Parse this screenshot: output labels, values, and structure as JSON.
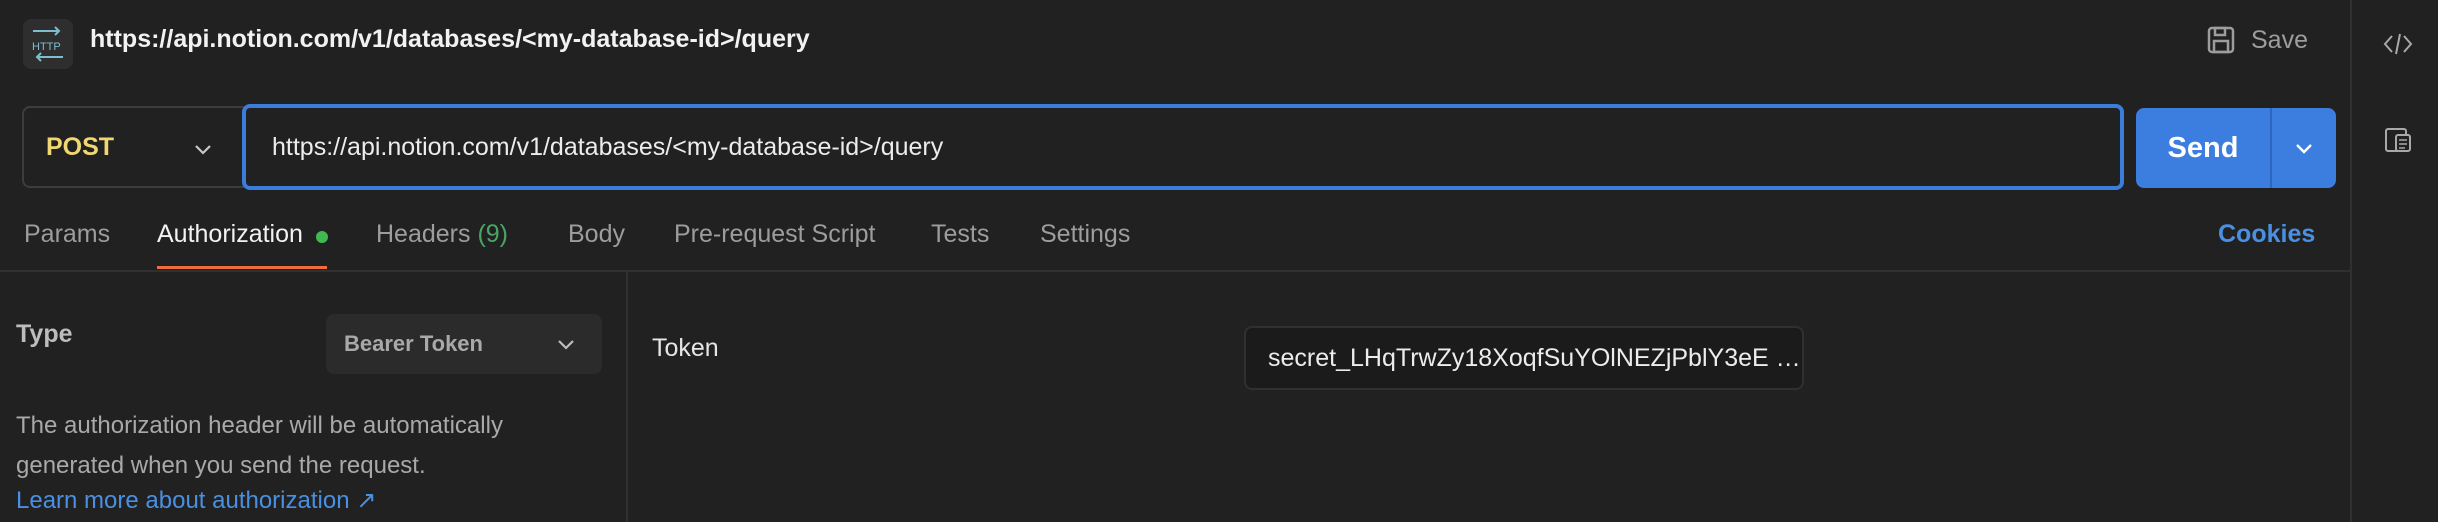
{
  "header": {
    "title": "https://api.notion.com/v1/databases/<my-database-id>/query",
    "save_label": "Save",
    "http_icon_text": "HTTP"
  },
  "request": {
    "method": "POST",
    "url": "https://api.notion.com/v1/databases/<my-database-id>/query",
    "send_label": "Send"
  },
  "tabs": [
    {
      "label": "Params"
    },
    {
      "label": "Authorization",
      "active": true,
      "has_indicator": true
    },
    {
      "label": "Headers",
      "count": "(9)"
    },
    {
      "label": "Body"
    },
    {
      "label": "Pre-request Script"
    },
    {
      "label": "Tests"
    },
    {
      "label": "Settings"
    }
  ],
  "cookies_label": "Cookies",
  "auth": {
    "type_label": "Type",
    "type_value": "Bearer Token",
    "description": "The authorization header will be automatically generated when you send the request.",
    "learn_more": "Learn more about authorization ↗",
    "token_label": "Token",
    "token_value": "secret_LHqTrwZy18XoqfSuYOlNEZjPblY3eE …"
  },
  "colors": {
    "accent": "#3c7ee0",
    "method": "#f1d771",
    "active_tab_underline": "#f26b3a",
    "indicator": "#3fb950",
    "link": "#4a90e2"
  },
  "icons": {
    "http": "http-icon",
    "save": "save-icon",
    "code": "code-icon",
    "docs": "documentation-icon",
    "chevron": "chevron-down-icon"
  }
}
